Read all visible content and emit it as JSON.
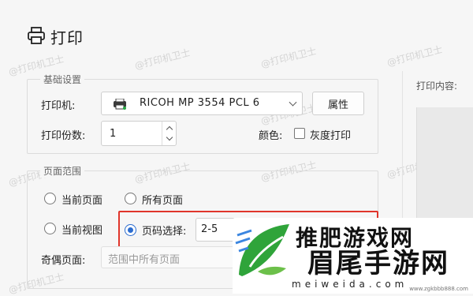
{
  "dialog": {
    "title": "打印"
  },
  "basic": {
    "legend": "基础设置",
    "printer_label": "打印机:",
    "printer_value": "RICOH MP 3554 PCL 6",
    "properties_button": "属性",
    "copies_label": "打印份数:",
    "copies_value": "1",
    "color_label": "颜色:",
    "grayscale_label": "灰度打印"
  },
  "range": {
    "legend": "页面范围",
    "current_page": "当前页面",
    "all_pages": "所有页面",
    "current_view": "当前视图",
    "page_select_label": "页码选择:",
    "page_select_value": "2-5",
    "odd_even_label": "奇偶页面:",
    "odd_even_value": "范围中所有页面"
  },
  "right": {
    "content_label": "打印内容:"
  },
  "watermark": "@打印机卫士",
  "logo": {
    "top_text": "推肥游戏网",
    "main_text": "眉尾手游网",
    "sub_text": "meiweida.com",
    "site_text": "www.zgkbbb888.com"
  },
  "colors": {
    "accent": "#2b6ccf",
    "highlight": "#e0352b"
  }
}
